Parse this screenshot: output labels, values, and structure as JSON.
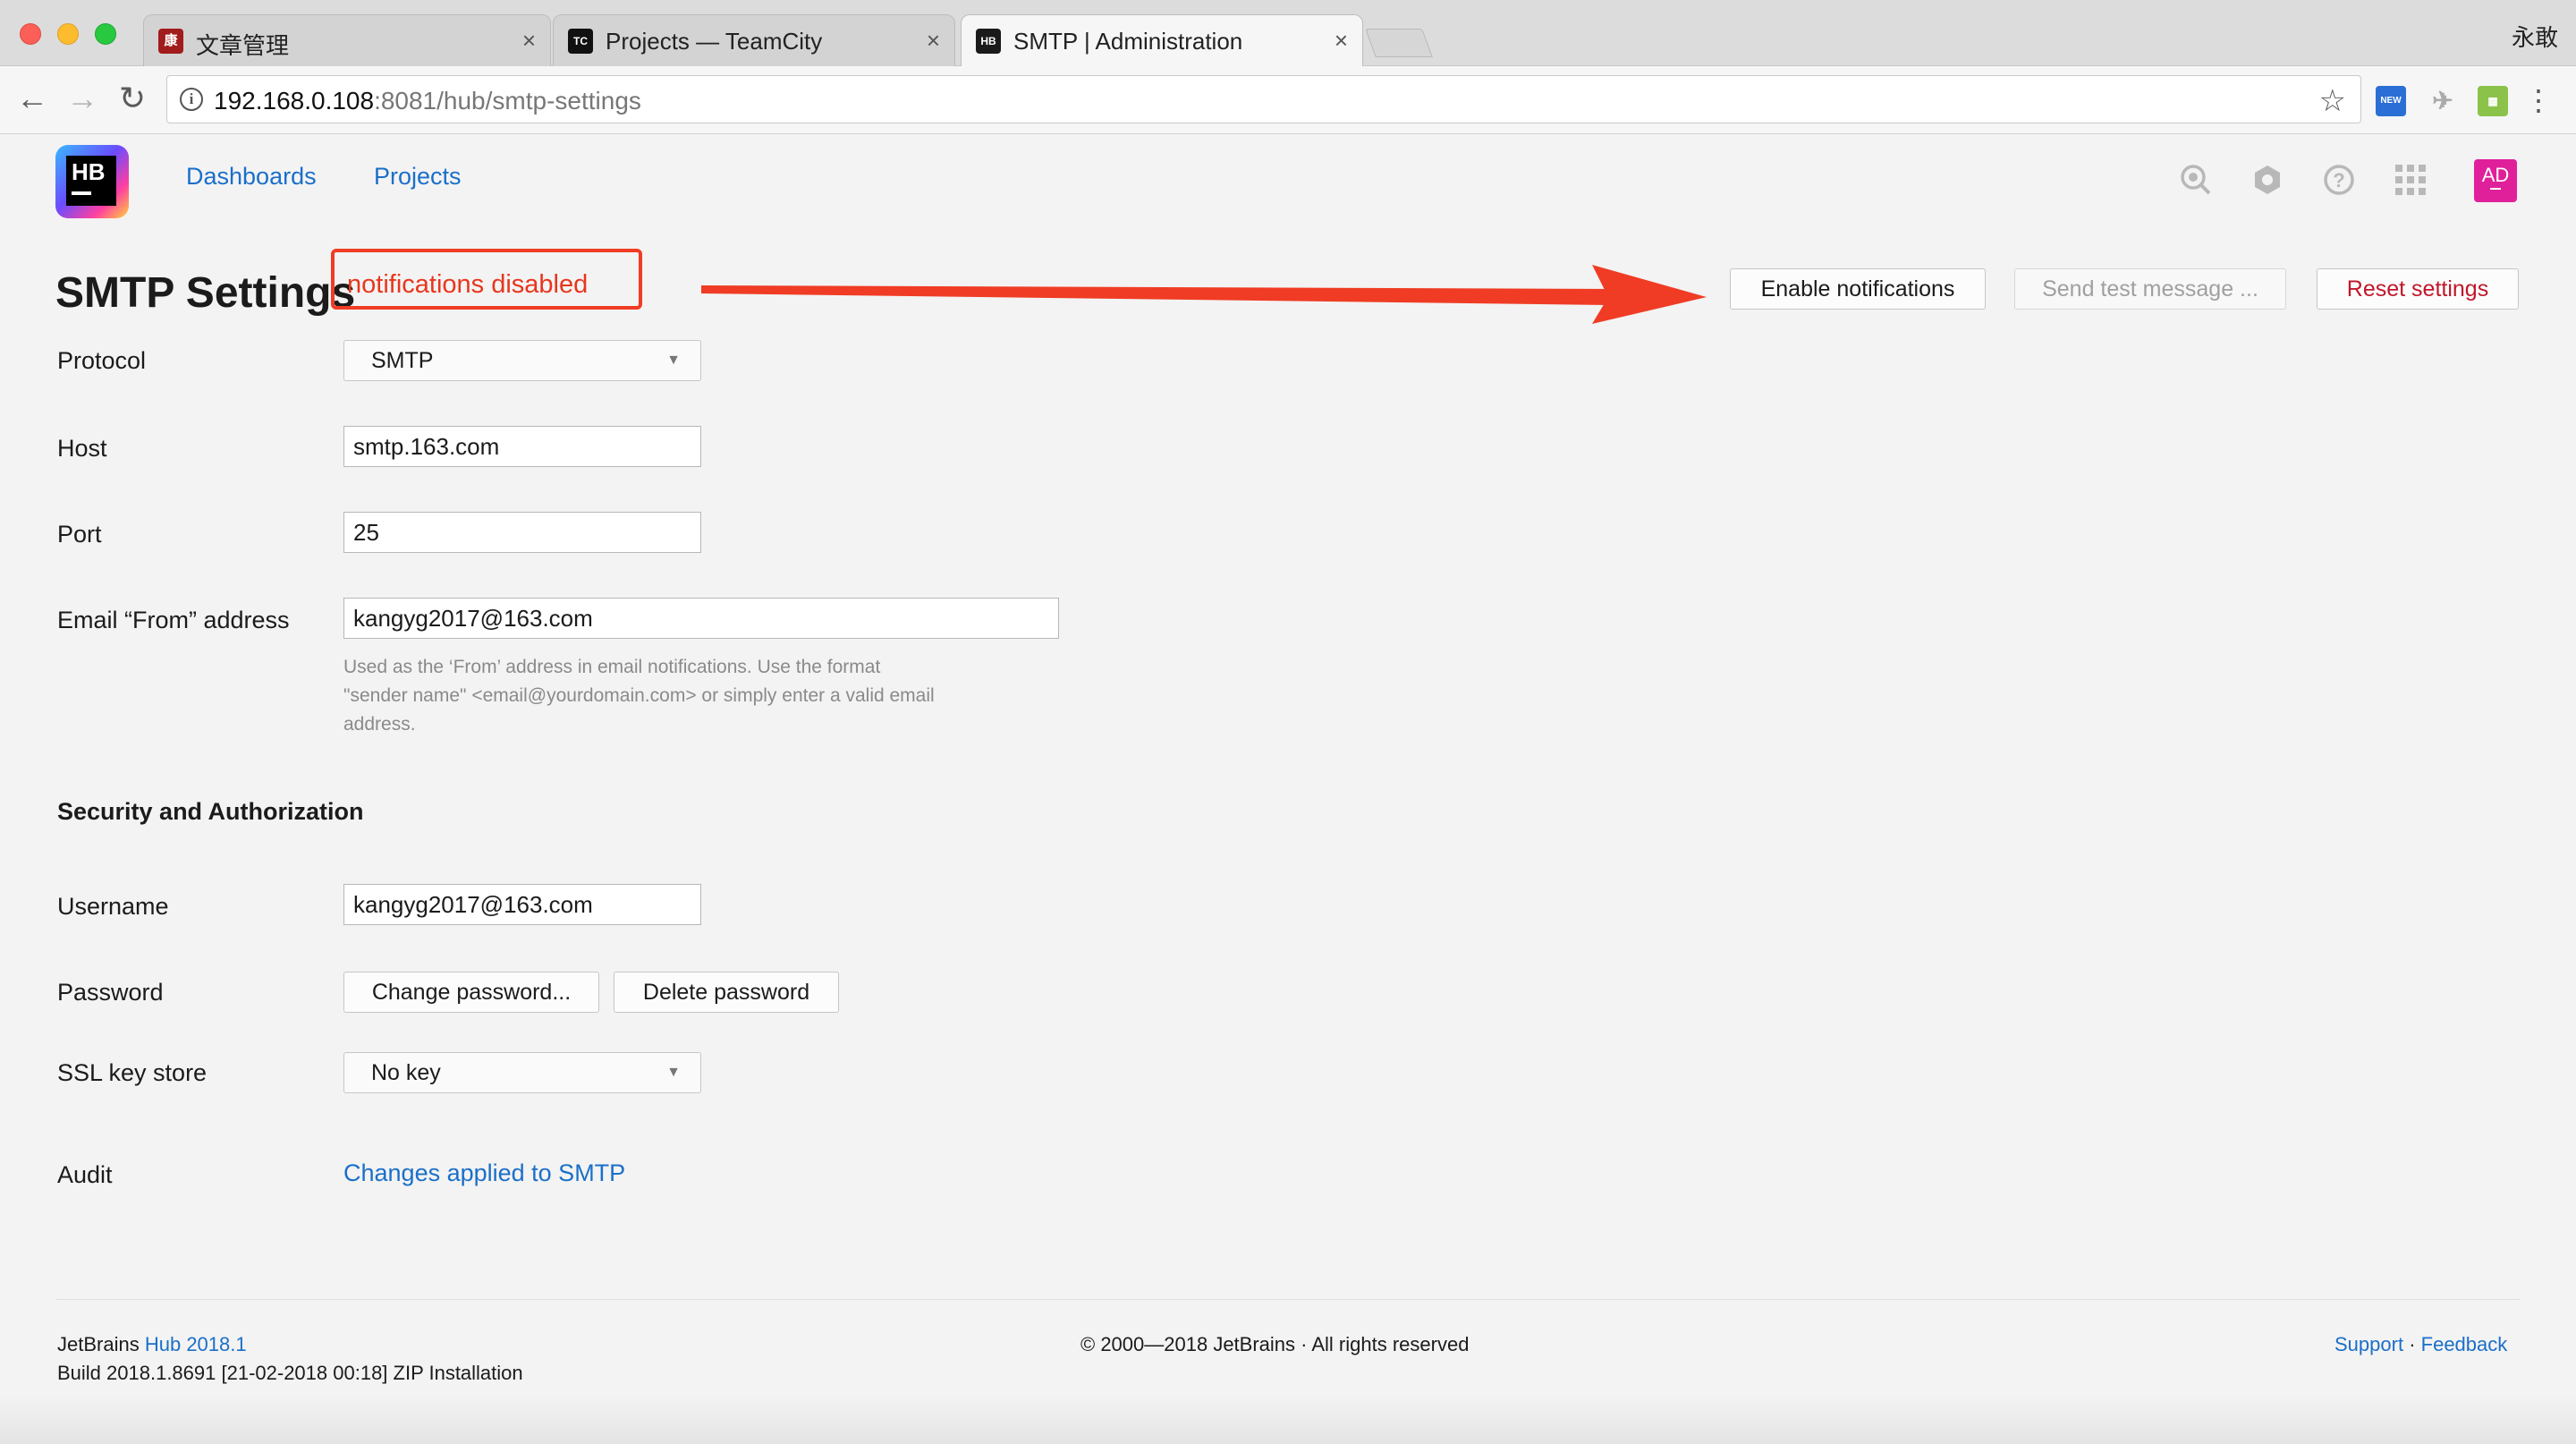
{
  "browser": {
    "tabs": [
      {
        "title": "文章管理",
        "favicon": "kang-favicon",
        "favicon_text": "康",
        "color": "#a11c1c"
      },
      {
        "title": "Projects — TeamCity",
        "favicon": "teamcity-favicon",
        "favicon_text": "TC",
        "color": "#111111"
      },
      {
        "title": "SMTP | Administration",
        "favicon": "hub-favicon",
        "favicon_text": "HB",
        "color": "#1a1a1a"
      }
    ],
    "tab_close": "×",
    "user_name": "永敢",
    "url_host": "192.168.0.108",
    "url_path": ":8081/hub/smtp-settings"
  },
  "hub": {
    "logo_text": "HB",
    "nav": {
      "dashboards": "Dashboards",
      "projects": "Projects"
    },
    "avatar_initials": "AD"
  },
  "page": {
    "title": "SMTP Settings",
    "annotation": "notifications disabled",
    "buttons": {
      "enable": "Enable notifications",
      "send_test": "Send test message ...",
      "reset": "Reset settings"
    },
    "form": {
      "protocol_label": "Protocol",
      "protocol_value": "SMTP",
      "host_label": "Host",
      "host_value": "smtp.163.com",
      "port_label": "Port",
      "port_value": "25",
      "from_label": "Email “From” address",
      "from_value": "kangyg2017@163.com",
      "from_hint_1": "Used as the ‘From’ address in email notifications. Use the format",
      "from_hint_2": "\"sender name\" <email@yourdomain.com> or simply enter a valid email",
      "from_hint_3": "address.",
      "security_title": "Security and Authorization",
      "username_label": "Username",
      "username_value": "kangyg2017@163.com",
      "password_label": "Password",
      "change_password": "Change password...",
      "delete_password": "Delete password",
      "ssl_label": "SSL key store",
      "ssl_value": "No key",
      "audit_label": "Audit",
      "audit_link": "Changes applied to SMTP"
    }
  },
  "footer": {
    "brand": "JetBrains",
    "product_link": "Hub 2018.1",
    "build": "Build 2018.1.8691 [21-02-2018 00:18] ZIP Installation",
    "copyright": "© 2000—2018 JetBrains · All rights reserved",
    "support": "Support",
    "separator": "·",
    "feedback": "Feedback"
  },
  "colors": {
    "accent": "#1a6fc9",
    "annotation": "#f03c24",
    "danger": "#c0172b",
    "avatar": "#e0209a"
  },
  "icons": [
    "back-arrow-icon",
    "forward-arrow-icon",
    "reload-icon",
    "info-icon",
    "star-icon",
    "search-icon",
    "settings-icon",
    "help-icon",
    "apps-grid-icon",
    "dropdown-caret-icon",
    "menu-dots-icon"
  ]
}
